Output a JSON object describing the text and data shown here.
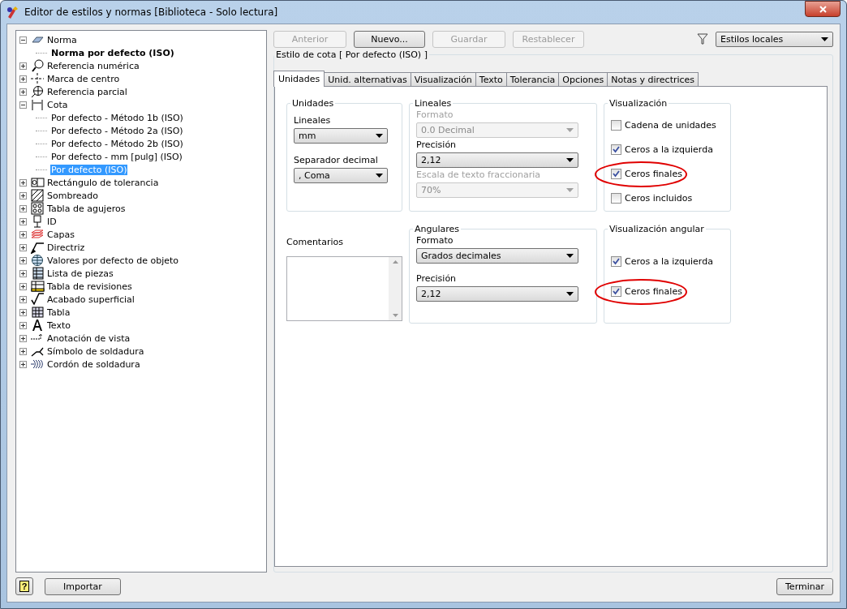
{
  "window": {
    "title": "Editor de estilos y normas [Biblioteca - Solo lectura]"
  },
  "tree": [
    {
      "label": "Norma",
      "expanded": true,
      "selected": false,
      "current": false,
      "children": [
        {
          "label": "Norma por defecto (ISO)",
          "selected": false,
          "current": true
        }
      ]
    },
    {
      "label": "Referencia numérica",
      "expanded": false,
      "selected": false,
      "current": false
    },
    {
      "label": "Marca de centro",
      "expanded": false,
      "selected": false,
      "current": false
    },
    {
      "label": "Referencia parcial",
      "expanded": false,
      "selected": false,
      "current": false
    },
    {
      "label": "Cota",
      "expanded": true,
      "selected": false,
      "current": false,
      "children": [
        {
          "label": "Por defecto - Método 1b (ISO)",
          "selected": false,
          "current": false
        },
        {
          "label": "Por defecto - Método 2a (ISO)",
          "selected": false,
          "current": false
        },
        {
          "label": "Por defecto - Método 2b (ISO)",
          "selected": false,
          "current": false
        },
        {
          "label": "Por defecto - mm [pulg] (ISO)",
          "selected": false,
          "current": false
        },
        {
          "label": "Por defecto (ISO)",
          "selected": true,
          "current": false
        }
      ]
    },
    {
      "label": "Rectángulo de tolerancia",
      "expanded": false,
      "selected": false,
      "current": false
    },
    {
      "label": "Sombreado",
      "expanded": false,
      "selected": false,
      "current": false
    },
    {
      "label": "Tabla de agujeros",
      "expanded": false,
      "selected": false,
      "current": false
    },
    {
      "label": "ID",
      "expanded": false,
      "selected": false,
      "current": false
    },
    {
      "label": "Capas",
      "expanded": false,
      "selected": false,
      "current": false
    },
    {
      "label": "Directriz",
      "expanded": false,
      "selected": false,
      "current": false
    },
    {
      "label": "Valores por defecto de objeto",
      "expanded": false,
      "selected": false,
      "current": false
    },
    {
      "label": "Lista de piezas",
      "expanded": false,
      "selected": false,
      "current": false
    },
    {
      "label": "Tabla de revisiones",
      "expanded": false,
      "selected": false,
      "current": false
    },
    {
      "label": "Acabado superficial",
      "expanded": false,
      "selected": false,
      "current": false
    },
    {
      "label": "Tabla",
      "expanded": false,
      "selected": false,
      "current": false
    },
    {
      "label": "Texto",
      "expanded": false,
      "selected": false,
      "current": false
    },
    {
      "label": "Anotación de vista",
      "expanded": false,
      "selected": false,
      "current": false
    },
    {
      "label": "Símbolo de soldadura",
      "expanded": false,
      "selected": false,
      "current": false
    },
    {
      "label": "Cordón de soldadura",
      "expanded": false,
      "selected": false,
      "current": false
    }
  ],
  "toolbar": {
    "buttons": [
      {
        "label": "Anterior",
        "disabled": true
      },
      {
        "label": "Nuevo...",
        "disabled": false
      },
      {
        "label": "Guardar",
        "disabled": true
      },
      {
        "label": "Restablecer",
        "disabled": true
      }
    ],
    "filter": {
      "value": "Estilos locales"
    }
  },
  "style_group": {
    "title": "Estilo de cota [ Por defecto (ISO) ]"
  },
  "tabs": [
    {
      "label": "Unidades",
      "selected": true
    },
    {
      "label": "Unid. alternativas",
      "selected": false
    },
    {
      "label": "Visualización",
      "selected": false
    },
    {
      "label": "Texto",
      "selected": false
    },
    {
      "label": "Tolerancia",
      "selected": false
    },
    {
      "label": "Opciones",
      "selected": false
    },
    {
      "label": "Notas y directrices",
      "selected": false
    }
  ],
  "units": {
    "title": "Unidades",
    "fields": [
      {
        "label": "Lineales",
        "value": "mm",
        "disabled": false
      },
      {
        "label": "Separador decimal",
        "value": ", Coma",
        "disabled": false
      }
    ]
  },
  "linear": {
    "title": "Lineales",
    "fields": [
      {
        "label": "Formato",
        "value": "0.0 Decimal",
        "disabled": true
      },
      {
        "label": "Precisión",
        "value": "2,12",
        "disabled": false
      },
      {
        "label": "Escala de texto fraccionaria",
        "value": "70%",
        "disabled": true
      }
    ]
  },
  "display": {
    "title": "Visualización",
    "options": [
      {
        "label": "Cadena de unidades",
        "checked": false,
        "circled": false
      },
      {
        "label": "Ceros a la izquierda",
        "checked": true,
        "circled": false
      },
      {
        "label": "Ceros finales",
        "checked": true,
        "circled": true
      },
      {
        "label": "Ceros incluidos",
        "checked": false,
        "circled": false
      }
    ]
  },
  "comments": {
    "label": "Comentarios"
  },
  "angular": {
    "title": "Angulares",
    "fields": [
      {
        "label": "Formato",
        "value": "Grados decimales",
        "disabled": false
      },
      {
        "label": "Precisión",
        "value": "2,12",
        "disabled": false
      }
    ]
  },
  "angular_display": {
    "title": "Visualización angular",
    "options": [
      {
        "label": "Ceros a la izquierda",
        "checked": true,
        "circled": false
      },
      {
        "label": "Ceros finales",
        "checked": true,
        "circled": true
      }
    ]
  },
  "footer": {
    "help": "?",
    "import": "Importar",
    "finish": "Terminar"
  }
}
